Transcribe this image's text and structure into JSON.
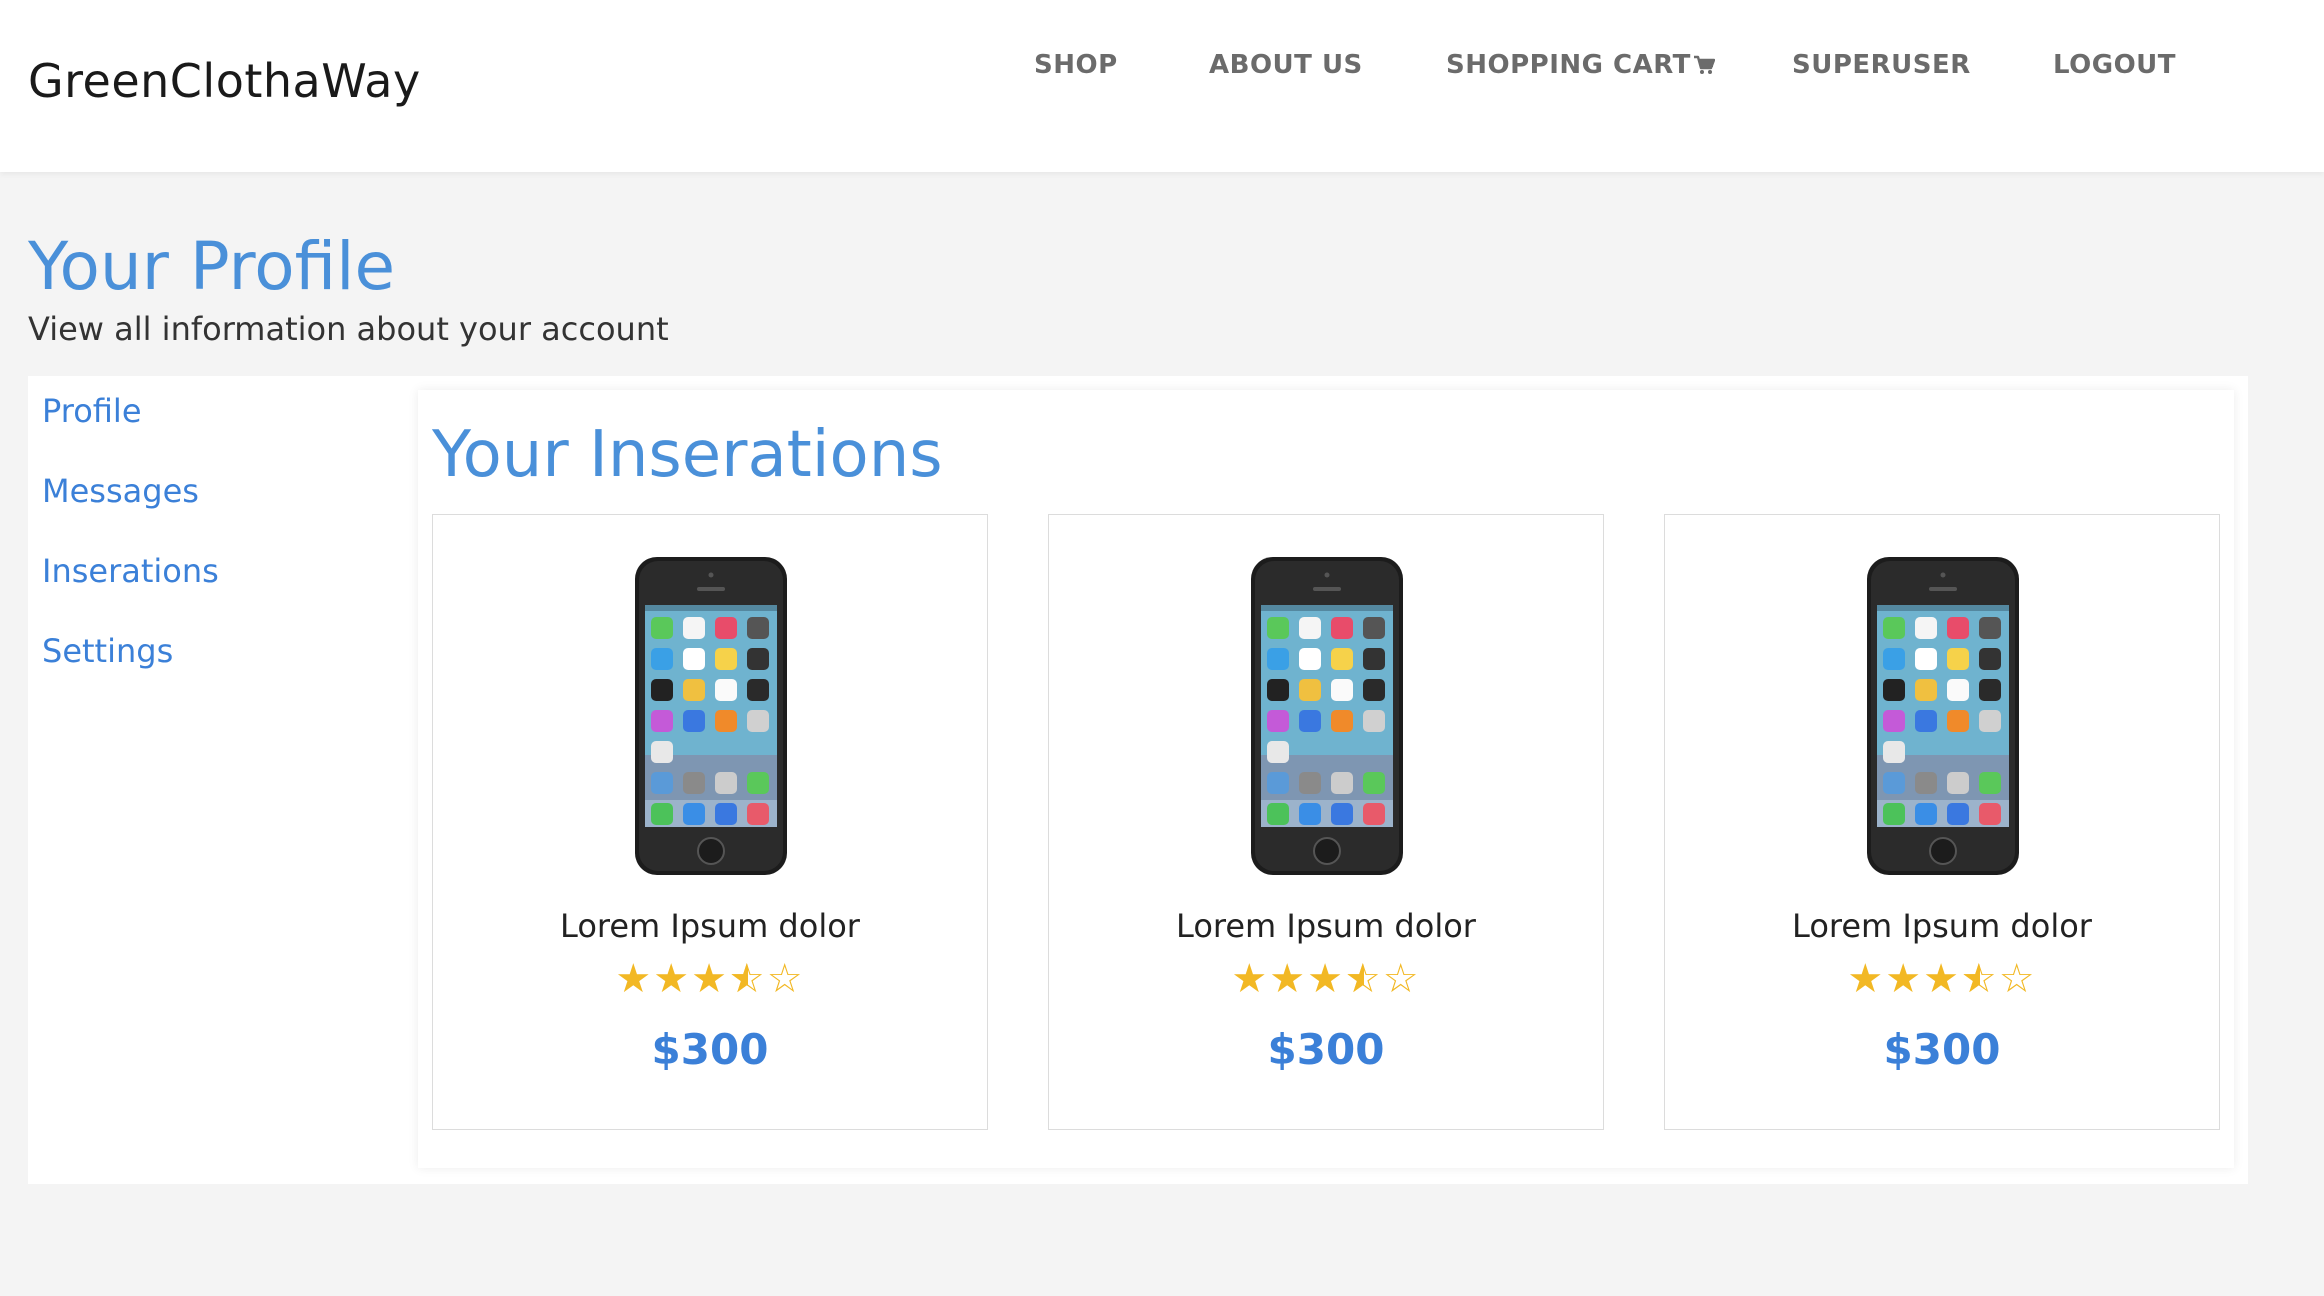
{
  "header": {
    "logo": "GreenClothaWay",
    "nav": [
      {
        "label": "SHOP"
      },
      {
        "label": "ABOUT US"
      },
      {
        "label": "SHOPPING CART"
      },
      {
        "label": "SUPERUSER"
      },
      {
        "label": "LOGOUT"
      }
    ]
  },
  "page": {
    "title": "Your Profile",
    "subtitle": "View all information about your account"
  },
  "sidebar": {
    "items": [
      {
        "label": "Profile"
      },
      {
        "label": "Messages"
      },
      {
        "label": "Inserations"
      },
      {
        "label": "Settings"
      }
    ]
  },
  "main": {
    "section_title": "Your Inserations",
    "products": [
      {
        "name": "Lorem Ipsum dolor",
        "rating": 3.5,
        "max_rating": 5,
        "price": "$300",
        "image": "smartphone"
      },
      {
        "name": "Lorem Ipsum dolor",
        "rating": 3.5,
        "max_rating": 5,
        "price": "$300",
        "image": "smartphone"
      },
      {
        "name": "Lorem Ipsum dolor",
        "rating": 3.5,
        "max_rating": 5,
        "price": "$300",
        "image": "smartphone"
      }
    ]
  },
  "colors": {
    "accent": "#4a90d9",
    "link": "#3b80d8",
    "star": "#f2b824",
    "nav_text": "#6b6b6b"
  }
}
